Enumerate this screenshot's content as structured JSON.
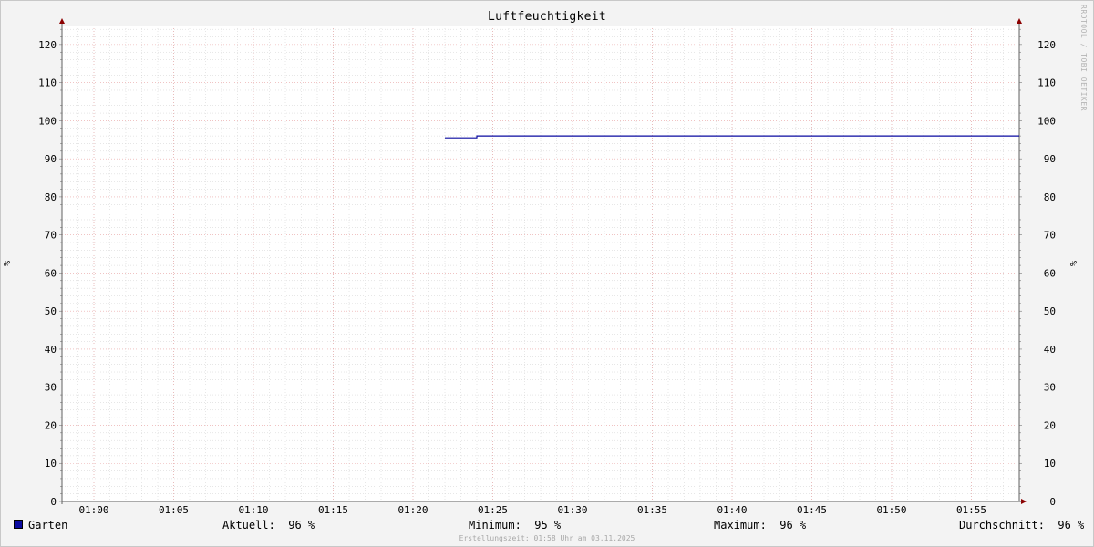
{
  "chart_data": {
    "type": "line",
    "title": "Luftfeuchtigkeit",
    "ylabel": "%",
    "ylabel_right": "%",
    "ylim": [
      0,
      125
    ],
    "yticks": [
      0,
      10,
      20,
      30,
      40,
      50,
      60,
      70,
      80,
      90,
      100,
      110,
      120
    ],
    "xlim": [
      "00:58",
      "01:58"
    ],
    "xticks": [
      "01:00",
      "01:05",
      "01:10",
      "01:15",
      "01:20",
      "01:25",
      "01:30",
      "01:35",
      "01:40",
      "01:45",
      "01:50",
      "01:55"
    ],
    "grid": true,
    "series": [
      {
        "name": "Garten",
        "color": "#0a0aa0",
        "points": [
          {
            "x": "01:22",
            "y": 95.5
          },
          {
            "x": "01:24",
            "y": 95.5
          },
          {
            "x": "01:24",
            "y": 96
          },
          {
            "x": "01:58",
            "y": 96
          }
        ]
      }
    ],
    "legend": "bottom-left"
  },
  "legend": {
    "series_name": "Garten",
    "stats": [
      {
        "label": "Aktuell:",
        "value": "96 %"
      },
      {
        "label": "Minimum:",
        "value": "95 %"
      },
      {
        "label": "Maximum:",
        "value": "96 %"
      },
      {
        "label": "Durchschnitt:",
        "value": "96 %"
      }
    ]
  },
  "watermark": "RRDTOOL / TOBI OETIKER",
  "footer": "Erstellungszeit: 01:58 Uhr am 03.11.2025",
  "colors": {
    "background": "#f3f3f3",
    "plot": "#ffffff",
    "grid_major": "#e8a0a0",
    "grid_minor": "#cfcfcf",
    "axis": "#606060",
    "arrow": "#8b0000"
  }
}
